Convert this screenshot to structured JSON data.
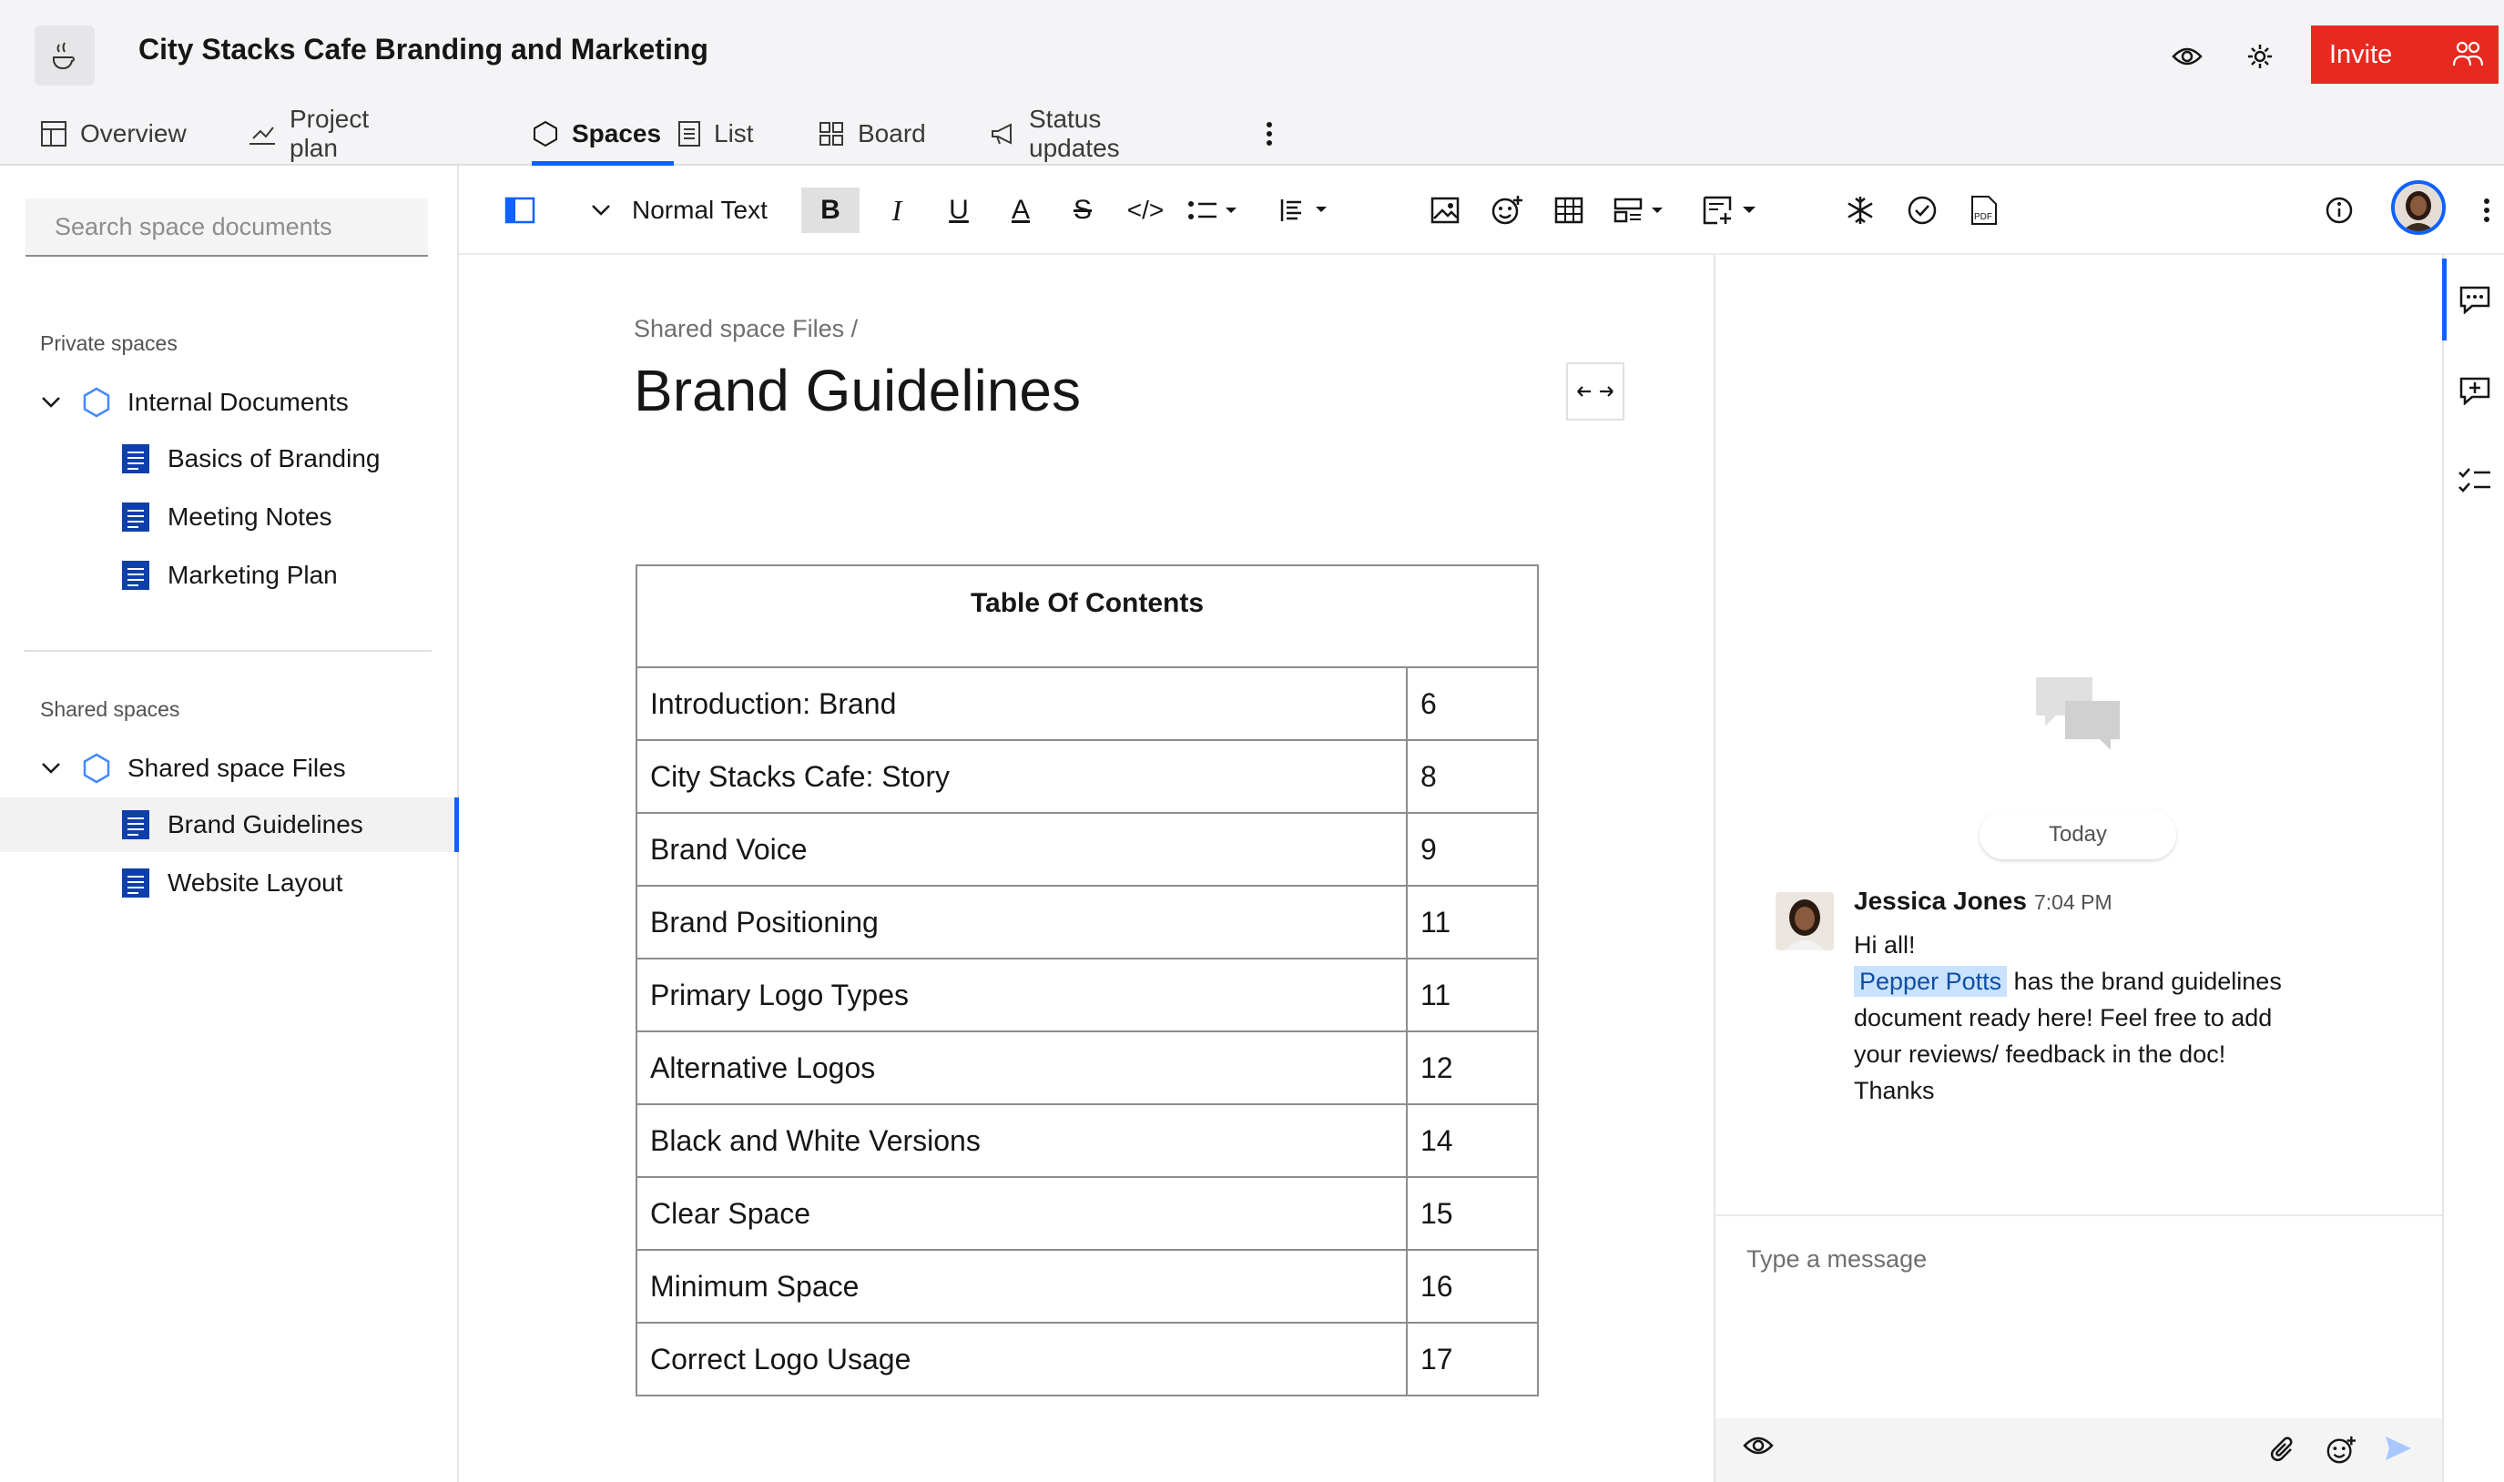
{
  "header": {
    "project_title": "City Stacks Cafe Branding and Marketing",
    "invite_label": "Invite",
    "tabs": [
      {
        "label": "Overview",
        "icon": "dashboard-icon"
      },
      {
        "label": "Project plan",
        "icon": "project-plan-icon"
      },
      {
        "label": "Spaces",
        "icon": "spaces-icon",
        "active": true
      },
      {
        "label": "List",
        "icon": "list-icon"
      },
      {
        "label": "Board",
        "icon": "board-icon"
      },
      {
        "label": "Status updates",
        "icon": "megaphone-icon"
      }
    ]
  },
  "sidebar": {
    "search_placeholder": "Search space documents",
    "private_label": "Private spaces",
    "private_folder": "Internal Documents",
    "private_docs": [
      "Basics of Branding",
      "Meeting Notes",
      "Marketing Plan"
    ],
    "shared_label": "Shared spaces",
    "shared_folder": "Shared space Files",
    "shared_docs": [
      "Brand Guidelines",
      "Website Layout"
    ]
  },
  "toolbar": {
    "text_style": "Normal Text"
  },
  "document": {
    "breadcrumb": "Shared space Files /",
    "title": "Brand Guidelines",
    "toc_heading": "Table Of Contents",
    "toc_rows": [
      {
        "title": "Introduction: Brand",
        "page": "6"
      },
      {
        "title": "City Stacks Cafe: Story",
        "page": "8"
      },
      {
        "title": "Brand Voice",
        "page": "9"
      },
      {
        "title": "Brand Positioning",
        "page": "11"
      },
      {
        "title": "Primary Logo Types",
        "page": "11"
      },
      {
        "title": "Alternative Logos",
        "page": "12"
      },
      {
        "title": "Black and White Versions",
        "page": "14"
      },
      {
        "title": "Clear Space",
        "page": "15"
      },
      {
        "title": "Minimum Space",
        "page": "16"
      },
      {
        "title": "Correct Logo Usage",
        "page": "17"
      }
    ]
  },
  "chat": {
    "day_label": "Today",
    "author": "Jessica Jones",
    "time": "7:04 PM",
    "line1": "Hi all!",
    "mention": "Pepper Potts",
    "line2": "has the brand guidelines document ready here! Feel free to add your reviews/ feedback in the doc!",
    "line3": "Thanks",
    "input_placeholder": "Type a message"
  },
  "colors": {
    "accent": "#0f62fe",
    "invite": "#e8291f",
    "doc_icon": "#0f3fa8"
  }
}
